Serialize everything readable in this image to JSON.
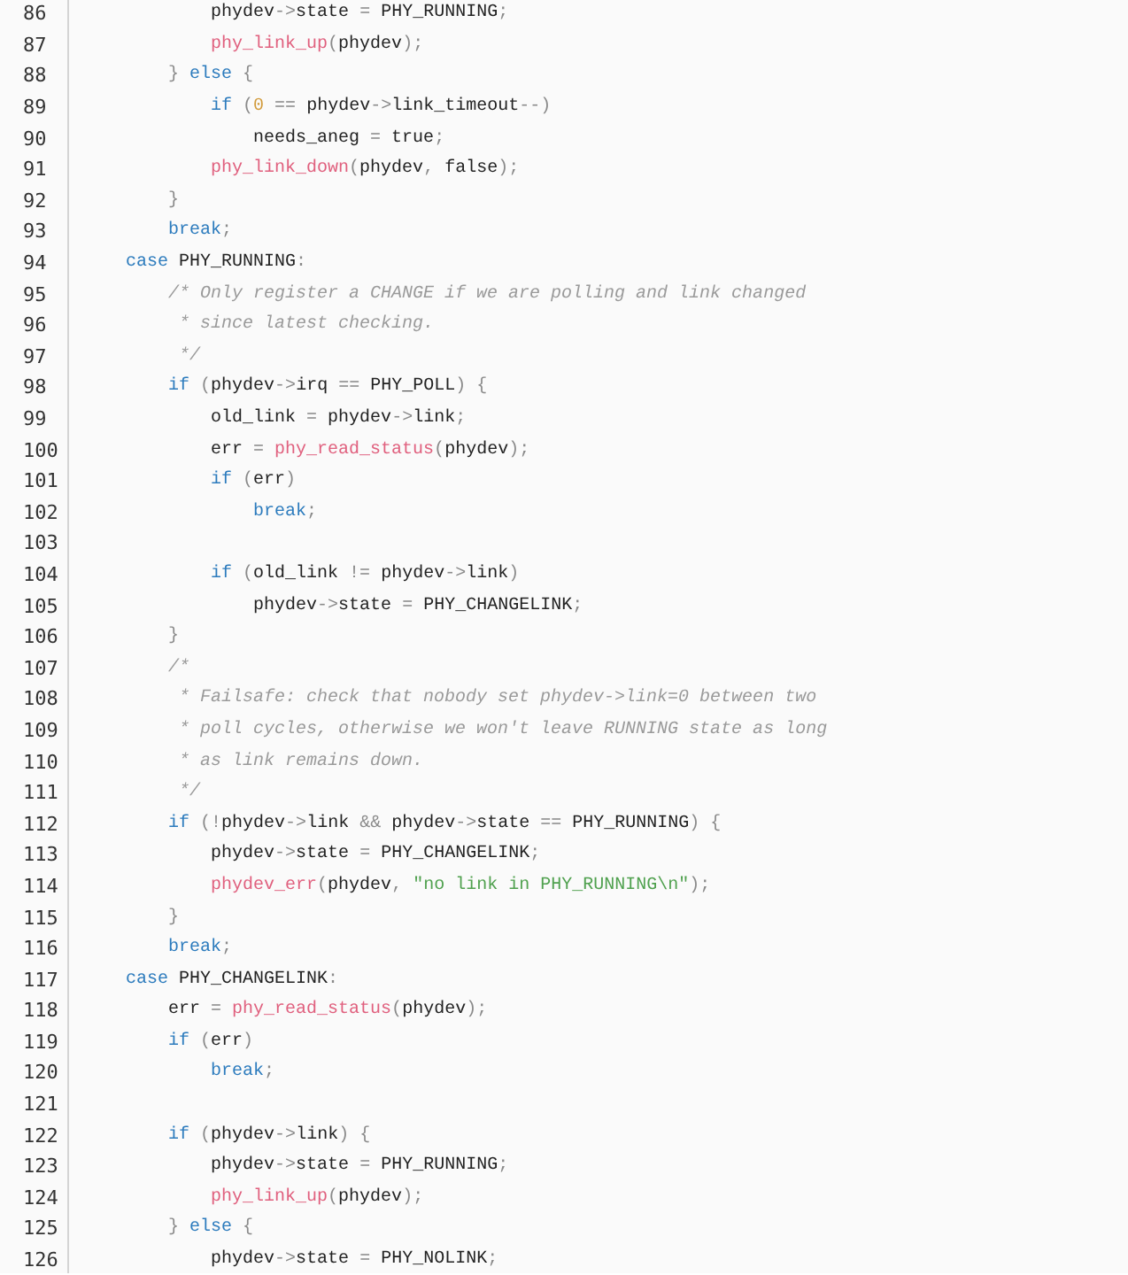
{
  "code_lines": [
    {
      "number": "86",
      "tokens": [
        {
          "kind": "plain",
          "text": "            phydev"
        },
        {
          "kind": "punct",
          "text": "->"
        },
        {
          "kind": "plain",
          "text": "state "
        },
        {
          "kind": "punct",
          "text": "="
        },
        {
          "kind": "plain",
          "text": " PHY_RUNNING"
        },
        {
          "kind": "punct",
          "text": ";"
        }
      ]
    },
    {
      "number": "87",
      "tokens": [
        {
          "kind": "function",
          "text": "            phy_link_up"
        },
        {
          "kind": "punct",
          "text": "("
        },
        {
          "kind": "plain",
          "text": "phydev"
        },
        {
          "kind": "punct",
          "text": ");"
        }
      ]
    },
    {
      "number": "88",
      "tokens": [
        {
          "kind": "punct",
          "text": "        } "
        },
        {
          "kind": "keyword",
          "text": "else"
        },
        {
          "kind": "punct",
          "text": " {"
        }
      ]
    },
    {
      "number": "89",
      "tokens": [
        {
          "kind": "keyword",
          "text": "            if"
        },
        {
          "kind": "punct",
          "text": " ("
        },
        {
          "kind": "number",
          "text": "0"
        },
        {
          "kind": "punct",
          "text": " == "
        },
        {
          "kind": "plain",
          "text": "phydev"
        },
        {
          "kind": "punct",
          "text": "->"
        },
        {
          "kind": "plain",
          "text": "link_timeout"
        },
        {
          "kind": "punct",
          "text": "--)"
        }
      ]
    },
    {
      "number": "90",
      "tokens": [
        {
          "kind": "plain",
          "text": "                needs_aneg "
        },
        {
          "kind": "punct",
          "text": "="
        },
        {
          "kind": "plain",
          "text": " true"
        },
        {
          "kind": "punct",
          "text": ";"
        }
      ]
    },
    {
      "number": "91",
      "tokens": [
        {
          "kind": "function",
          "text": "            phy_link_down"
        },
        {
          "kind": "punct",
          "text": "("
        },
        {
          "kind": "plain",
          "text": "phydev"
        },
        {
          "kind": "punct",
          "text": ", "
        },
        {
          "kind": "plain",
          "text": "false"
        },
        {
          "kind": "punct",
          "text": ");"
        }
      ]
    },
    {
      "number": "92",
      "tokens": [
        {
          "kind": "punct",
          "text": "        }"
        }
      ]
    },
    {
      "number": "93",
      "tokens": [
        {
          "kind": "keyword",
          "text": "        break"
        },
        {
          "kind": "punct",
          "text": ";"
        }
      ]
    },
    {
      "number": "94",
      "tokens": [
        {
          "kind": "keyword",
          "text": "    case"
        },
        {
          "kind": "plain",
          "text": " PHY_RUNNING"
        },
        {
          "kind": "punct",
          "text": ":"
        }
      ]
    },
    {
      "number": "95",
      "tokens": [
        {
          "kind": "comment",
          "text": "        /* Only register a CHANGE if we are polling and link changed"
        }
      ]
    },
    {
      "number": "96",
      "tokens": [
        {
          "kind": "comment",
          "text": "         * since latest checking."
        }
      ]
    },
    {
      "number": "97",
      "tokens": [
        {
          "kind": "comment",
          "text": "         */"
        }
      ]
    },
    {
      "number": "98",
      "tokens": [
        {
          "kind": "keyword",
          "text": "        if"
        },
        {
          "kind": "punct",
          "text": " ("
        },
        {
          "kind": "plain",
          "text": "phydev"
        },
        {
          "kind": "punct",
          "text": "->"
        },
        {
          "kind": "plain",
          "text": "irq "
        },
        {
          "kind": "punct",
          "text": "=="
        },
        {
          "kind": "plain",
          "text": " PHY_POLL"
        },
        {
          "kind": "punct",
          "text": ") {"
        }
      ]
    },
    {
      "number": "99",
      "tokens": [
        {
          "kind": "plain",
          "text": "            old_link "
        },
        {
          "kind": "punct",
          "text": "="
        },
        {
          "kind": "plain",
          "text": " phydev"
        },
        {
          "kind": "punct",
          "text": "->"
        },
        {
          "kind": "plain",
          "text": "link"
        },
        {
          "kind": "punct",
          "text": ";"
        }
      ]
    },
    {
      "number": "100",
      "tokens": [
        {
          "kind": "plain",
          "text": "            err "
        },
        {
          "kind": "punct",
          "text": "= "
        },
        {
          "kind": "function",
          "text": "phy_read_status"
        },
        {
          "kind": "punct",
          "text": "("
        },
        {
          "kind": "plain",
          "text": "phydev"
        },
        {
          "kind": "punct",
          "text": ");"
        }
      ]
    },
    {
      "number": "101",
      "tokens": [
        {
          "kind": "keyword",
          "text": "            if"
        },
        {
          "kind": "punct",
          "text": " ("
        },
        {
          "kind": "plain",
          "text": "err"
        },
        {
          "kind": "punct",
          "text": ")"
        }
      ]
    },
    {
      "number": "102",
      "tokens": [
        {
          "kind": "keyword",
          "text": "                break"
        },
        {
          "kind": "punct",
          "text": ";"
        }
      ]
    },
    {
      "number": "103"
    },
    {
      "number": "104",
      "tokens": [
        {
          "kind": "keyword",
          "text": "            if"
        },
        {
          "kind": "punct",
          "text": " ("
        },
        {
          "kind": "plain",
          "text": "old_link "
        },
        {
          "kind": "punct",
          "text": "!="
        },
        {
          "kind": "plain",
          "text": " phydev"
        },
        {
          "kind": "punct",
          "text": "->"
        },
        {
          "kind": "plain",
          "text": "link"
        },
        {
          "kind": "punct",
          "text": ")"
        }
      ]
    },
    {
      "number": "105",
      "tokens": [
        {
          "kind": "plain",
          "text": "                phydev"
        },
        {
          "kind": "punct",
          "text": "->"
        },
        {
          "kind": "plain",
          "text": "state "
        },
        {
          "kind": "punct",
          "text": "="
        },
        {
          "kind": "plain",
          "text": " PHY_CHANGELINK"
        },
        {
          "kind": "punct",
          "text": ";"
        }
      ]
    },
    {
      "number": "106",
      "tokens": [
        {
          "kind": "punct",
          "text": "        }"
        }
      ]
    },
    {
      "number": "107",
      "tokens": [
        {
          "kind": "comment",
          "text": "        /*"
        }
      ]
    },
    {
      "number": "108",
      "tokens": [
        {
          "kind": "comment",
          "text": "         * Failsafe: check that nobody set phydev->link=0 between two"
        }
      ]
    },
    {
      "number": "109",
      "tokens": [
        {
          "kind": "comment",
          "text": "         * poll cycles, otherwise we won't leave RUNNING state as long"
        }
      ]
    },
    {
      "number": "110",
      "tokens": [
        {
          "kind": "comment",
          "text": "         * as link remains down."
        }
      ]
    },
    {
      "number": "111",
      "tokens": [
        {
          "kind": "comment",
          "text": "         */"
        }
      ]
    },
    {
      "number": "112",
      "tokens": [
        {
          "kind": "keyword",
          "text": "        if"
        },
        {
          "kind": "punct",
          "text": " (!"
        },
        {
          "kind": "plain",
          "text": "phydev"
        },
        {
          "kind": "punct",
          "text": "->"
        },
        {
          "kind": "plain",
          "text": "link "
        },
        {
          "kind": "punct",
          "text": "&&"
        },
        {
          "kind": "plain",
          "text": " phydev"
        },
        {
          "kind": "punct",
          "text": "->"
        },
        {
          "kind": "plain",
          "text": "state "
        },
        {
          "kind": "punct",
          "text": "=="
        },
        {
          "kind": "plain",
          "text": " PHY_RUNNING"
        },
        {
          "kind": "punct",
          "text": ") {"
        }
      ]
    },
    {
      "number": "113",
      "tokens": [
        {
          "kind": "plain",
          "text": "            phydev"
        },
        {
          "kind": "punct",
          "text": "->"
        },
        {
          "kind": "plain",
          "text": "state "
        },
        {
          "kind": "punct",
          "text": "="
        },
        {
          "kind": "plain",
          "text": " PHY_CHANGELINK"
        },
        {
          "kind": "punct",
          "text": ";"
        }
      ]
    },
    {
      "number": "114",
      "tokens": [
        {
          "kind": "function",
          "text": "            phydev_err"
        },
        {
          "kind": "punct",
          "text": "("
        },
        {
          "kind": "plain",
          "text": "phydev"
        },
        {
          "kind": "punct",
          "text": ", "
        },
        {
          "kind": "string",
          "text": "\"no link in PHY_RUNNING\\n\""
        },
        {
          "kind": "punct",
          "text": ");"
        }
      ]
    },
    {
      "number": "115",
      "tokens": [
        {
          "kind": "punct",
          "text": "        }"
        }
      ]
    },
    {
      "number": "116",
      "tokens": [
        {
          "kind": "keyword",
          "text": "        break"
        },
        {
          "kind": "punct",
          "text": ";"
        }
      ]
    },
    {
      "number": "117",
      "tokens": [
        {
          "kind": "keyword",
          "text": "    case"
        },
        {
          "kind": "plain",
          "text": " PHY_CHANGELINK"
        },
        {
          "kind": "punct",
          "text": ":"
        }
      ]
    },
    {
      "number": "118",
      "tokens": [
        {
          "kind": "plain",
          "text": "        err "
        },
        {
          "kind": "punct",
          "text": "= "
        },
        {
          "kind": "function",
          "text": "phy_read_status"
        },
        {
          "kind": "punct",
          "text": "("
        },
        {
          "kind": "plain",
          "text": "phydev"
        },
        {
          "kind": "punct",
          "text": ");"
        }
      ]
    },
    {
      "number": "119",
      "tokens": [
        {
          "kind": "keyword",
          "text": "        if"
        },
        {
          "kind": "punct",
          "text": " ("
        },
        {
          "kind": "plain",
          "text": "err"
        },
        {
          "kind": "punct",
          "text": ")"
        }
      ]
    },
    {
      "number": "120",
      "tokens": [
        {
          "kind": "keyword",
          "text": "            break"
        },
        {
          "kind": "punct",
          "text": ";"
        }
      ]
    },
    {
      "number": "121"
    },
    {
      "number": "122",
      "tokens": [
        {
          "kind": "keyword",
          "text": "        if"
        },
        {
          "kind": "punct",
          "text": " ("
        },
        {
          "kind": "plain",
          "text": "phydev"
        },
        {
          "kind": "punct",
          "text": "->"
        },
        {
          "kind": "plain",
          "text": "link"
        },
        {
          "kind": "punct",
          "text": ") {"
        }
      ]
    },
    {
      "number": "123",
      "tokens": [
        {
          "kind": "plain",
          "text": "            phydev"
        },
        {
          "kind": "punct",
          "text": "->"
        },
        {
          "kind": "plain",
          "text": "state "
        },
        {
          "kind": "punct",
          "text": "="
        },
        {
          "kind": "plain",
          "text": " PHY_RUNNING"
        },
        {
          "kind": "punct",
          "text": ";"
        }
      ]
    },
    {
      "number": "124",
      "tokens": [
        {
          "kind": "function",
          "text": "            phy_link_up"
        },
        {
          "kind": "punct",
          "text": "("
        },
        {
          "kind": "plain",
          "text": "phydev"
        },
        {
          "kind": "punct",
          "text": ");"
        }
      ]
    },
    {
      "number": "125",
      "tokens": [
        {
          "kind": "punct",
          "text": "        } "
        },
        {
          "kind": "keyword",
          "text": "else"
        },
        {
          "kind": "punct",
          "text": " {"
        }
      ]
    },
    {
      "number": "126",
      "tokens": [
        {
          "kind": "plain",
          "text": "            phydev"
        },
        {
          "kind": "punct",
          "text": "->"
        },
        {
          "kind": "plain",
          "text": "state "
        },
        {
          "kind": "punct",
          "text": "="
        },
        {
          "kind": "plain",
          "text": " PHY_NOLINK"
        },
        {
          "kind": "punct",
          "text": ";"
        }
      ]
    }
  ]
}
